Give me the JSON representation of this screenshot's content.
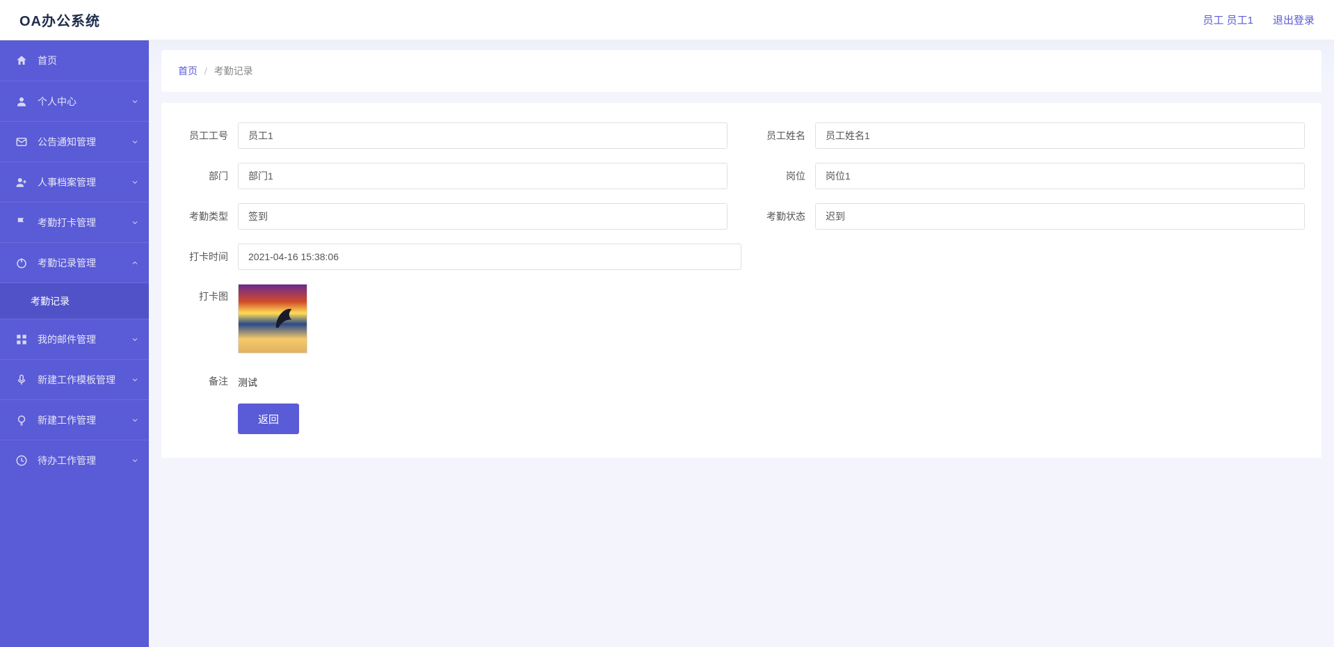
{
  "header": {
    "logo": "OA办公系统",
    "user_label": "员工 员工1",
    "logout": "退出登录"
  },
  "sidebar": {
    "items": [
      {
        "label": "首页",
        "icon": "home"
      },
      {
        "label": "个人中心",
        "icon": "user",
        "expandable": true
      },
      {
        "label": "公告通知管理",
        "icon": "mail",
        "expandable": true
      },
      {
        "label": "人事档案管理",
        "icon": "person",
        "expandable": true
      },
      {
        "label": "考勤打卡管理",
        "icon": "flag",
        "expandable": true
      },
      {
        "label": "考勤记录管理",
        "icon": "power",
        "expandable": true,
        "open": true
      },
      {
        "label": "我的邮件管理",
        "icon": "grid",
        "expandable": true
      },
      {
        "label": "新建工作模板管理",
        "icon": "mic",
        "expandable": true
      },
      {
        "label": "新建工作管理",
        "icon": "bulb",
        "expandable": true
      },
      {
        "label": "待办工作管理",
        "icon": "clock",
        "expandable": true
      }
    ],
    "submenu": {
      "label": "考勤记录"
    }
  },
  "breadcrumb": {
    "home": "首页",
    "current": "考勤记录"
  },
  "form": {
    "employee_id": {
      "label": "员工工号",
      "value": "员工1"
    },
    "employee_name": {
      "label": "员工姓名",
      "value": "员工姓名1"
    },
    "department": {
      "label": "部门",
      "value": "部门1"
    },
    "position": {
      "label": "岗位",
      "value": "岗位1"
    },
    "attend_type": {
      "label": "考勤类型",
      "value": "签到"
    },
    "attend_status": {
      "label": "考勤状态",
      "value": "迟到"
    },
    "clock_time": {
      "label": "打卡时间",
      "value": "2021-04-16 15:38:06"
    },
    "clock_img": {
      "label": "打卡图"
    },
    "remark": {
      "label": "备注",
      "value": "测试"
    },
    "back_button": "返回"
  }
}
